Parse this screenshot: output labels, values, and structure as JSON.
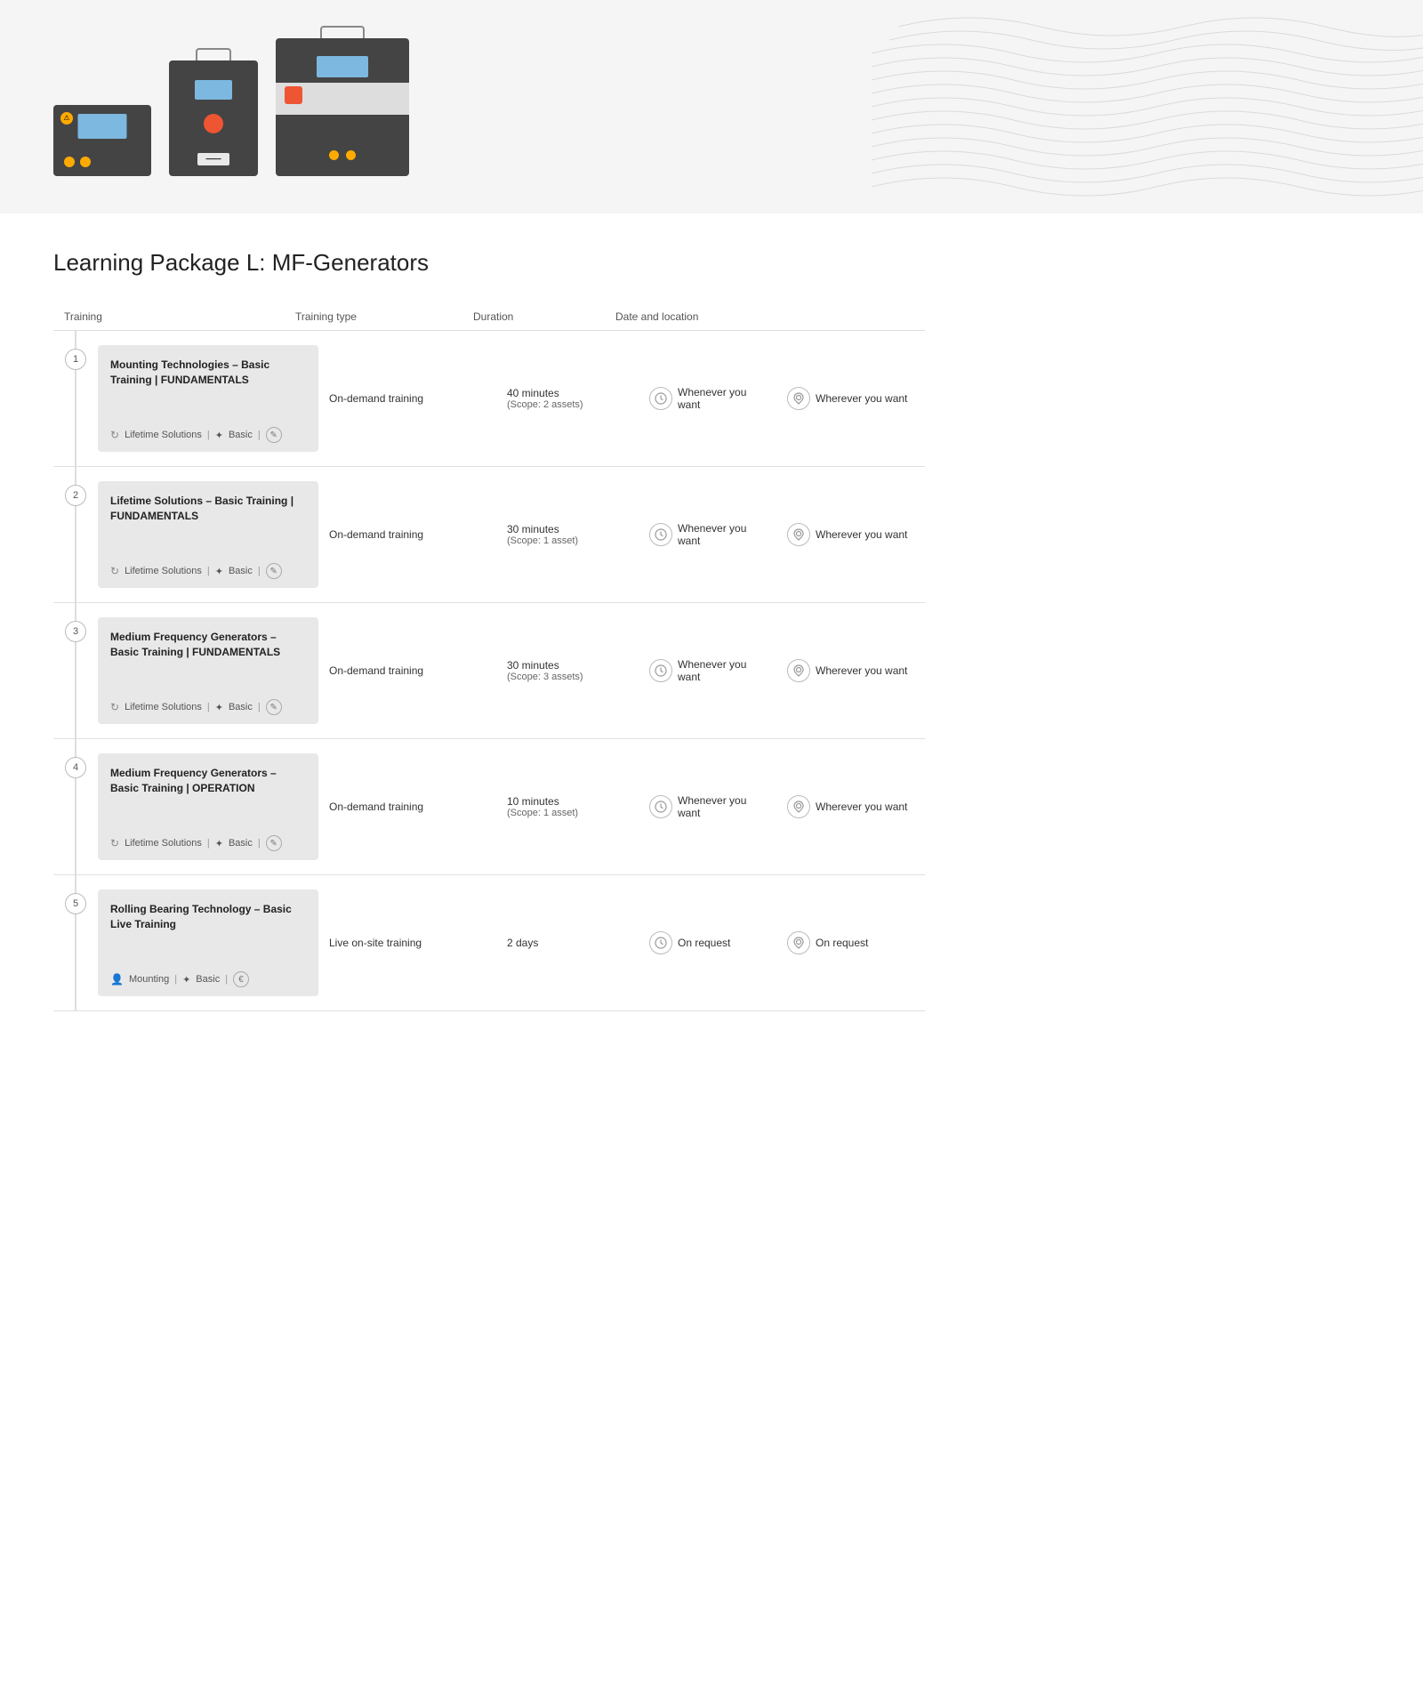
{
  "hero": {
    "alt": "MF-Generator machines"
  },
  "page": {
    "title": "Learning Package L: MF-Generators"
  },
  "table": {
    "headers": {
      "training": "Training",
      "type": "Training type",
      "duration": "Duration",
      "date": "Date and location",
      "location": ""
    },
    "rows": [
      {
        "number": "1",
        "title": "Mounting Technologies – Basic Training | FUNDAMENTALS",
        "meta_icon": "↻",
        "meta_label": "Lifetime Solutions",
        "meta_level": "Basic",
        "meta_extra": "✎",
        "type": "On-demand training",
        "duration": "40 minutes",
        "scope": "(Scope: 2 assets)",
        "date_label": "Whenever you want",
        "location_label": "Wherever you want"
      },
      {
        "number": "2",
        "title": "Lifetime Solutions – Basic Training | FUNDAMENTALS",
        "meta_icon": "↻",
        "meta_label": "Lifetime Solutions",
        "meta_level": "Basic",
        "meta_extra": "✎",
        "type": "On-demand training",
        "duration": "30 minutes",
        "scope": "(Scope: 1 asset)",
        "date_label": "Whenever you want",
        "location_label": "Wherever you want"
      },
      {
        "number": "3",
        "title": "Medium Frequency Generators – Basic Training | FUNDAMENTALS",
        "meta_icon": "↻",
        "meta_label": "Lifetime Solutions",
        "meta_level": "Basic",
        "meta_extra": "✎",
        "type": "On-demand training",
        "duration": "30 minutes",
        "scope": "(Scope: 3 assets)",
        "date_label": "Whenever you want",
        "location_label": "Wherever you want"
      },
      {
        "number": "4",
        "title": "Medium Frequency Generators – Basic Training | OPERATION",
        "meta_icon": "↻",
        "meta_label": "Lifetime Solutions",
        "meta_level": "Basic",
        "meta_extra": "✎",
        "type": "On-demand training",
        "duration": "10 minutes",
        "scope": "(Scope: 1 asset)",
        "date_label": "Whenever you want",
        "location_label": "Wherever you want"
      },
      {
        "number": "5",
        "title": "Rolling Bearing Technology – Basic Live Training",
        "meta_icon": "👤",
        "meta_label": "Mounting",
        "meta_level": "Basic",
        "meta_extra": "€",
        "type": "Live on-site training",
        "duration": "2 days",
        "scope": "",
        "date_label": "On request",
        "location_label": "On request"
      }
    ]
  }
}
